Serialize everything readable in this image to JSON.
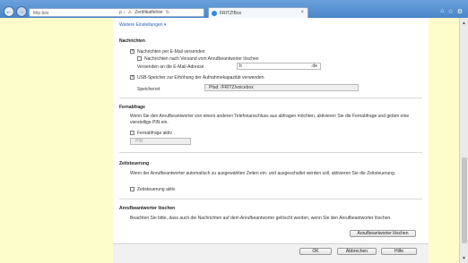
{
  "browser": {
    "url": "fritz.box",
    "search_hint": "ρ ↓",
    "cert_error": "Zertifikatfehler",
    "tab_title": "FRITZ!Box",
    "close": "×"
  },
  "page": {
    "more_settings": "Weitere Einstellungen ▾",
    "nachrichten": {
      "heading": "Nachrichten",
      "email_send": "Nachrichten per E-Mail versenden",
      "delete_after": "Nachrichten nach Versand vom Anrufbeantworter löschen",
      "email_label": "Versenden an die E-Mail-Adresse",
      "email_user": "b",
      "email_domain": ".de",
      "usb": "USB-Speicher zur Erhöhung der Aufnahmekapazität verwenden",
      "storage_label": "Speicherort",
      "storage_value": "Pfad: /FRITZ/voicebox"
    },
    "fernabfrage": {
      "heading": "Fernabfrage",
      "desc": "Wenn Sie den Anrufbeantworter von einem anderen Telefonanschluss aus abfragen möchten, aktivieren Sie die Fernabfrage und geben eine vierstellige PIN ein.",
      "checkbox": "Fernabfrage aktiv",
      "pin_placeholder": "PIN"
    },
    "zeitsteuerung": {
      "heading": "Zeitsteuerung",
      "desc": "Wenn der Anrufbeantworter automatisch zu ausgewählten Zeiten ein- und ausgeschaltet werden soll, aktivieren Sie die Zeitsteuerung.",
      "checkbox": "Zeitsteuerung aktiv"
    },
    "loeschen": {
      "heading": "Anrufbeantworter löschen",
      "desc": "Beachten Sie bitte, dass auch die Nachrichten auf dem Anrufbeantworter gelöscht werden, wenn Sie den Anrufbeantworter löschen.",
      "button": "Anrufbeantworter löschen"
    },
    "footer": {
      "ok": "OK",
      "cancel": "Abbrechen",
      "help": "Hilfe"
    }
  },
  "colors": {
    "side_background": "#fdfdcc",
    "link": "#2a63b5"
  }
}
